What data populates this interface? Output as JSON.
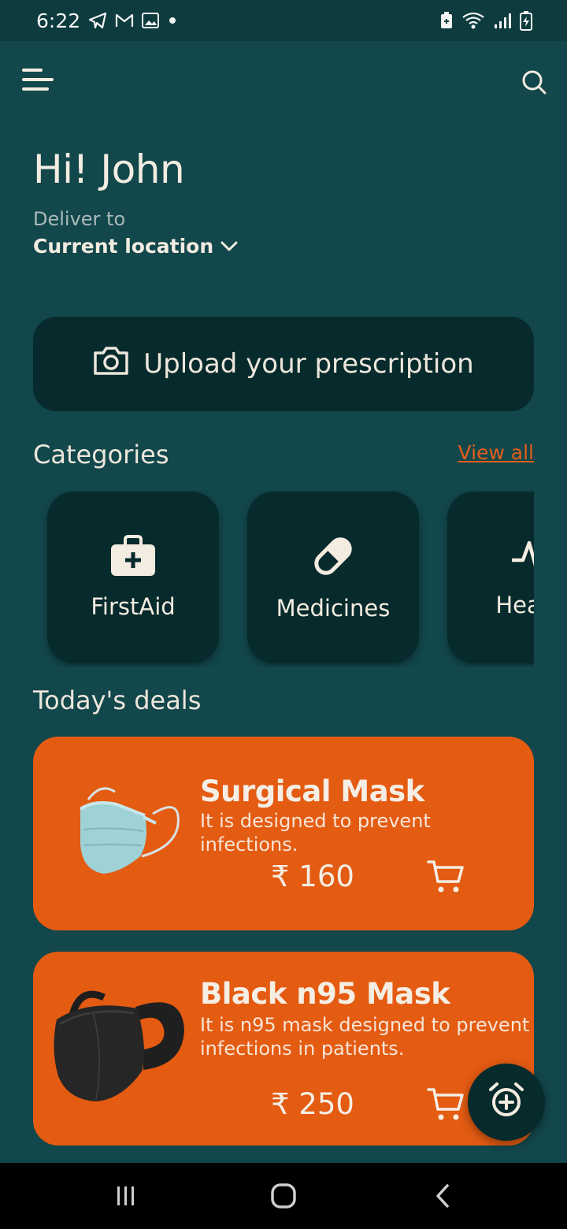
{
  "status_bar": {
    "time": "6:22",
    "left_icons": [
      "telegram-icon",
      "gmail-icon",
      "gallery-icon",
      "notification-dot-icon"
    ],
    "right_icons": [
      "battery-saver-icon",
      "wifi-icon",
      "signal-icon",
      "battery-charging-icon"
    ]
  },
  "header": {
    "menu_icon": "menu-icon",
    "search_icon": "search-icon"
  },
  "greeting": "Hi! John",
  "delivery": {
    "label": "Deliver to",
    "location": "Current location"
  },
  "upload": {
    "label": "Upload your prescription",
    "icon": "camera-icon"
  },
  "categories": {
    "title": "Categories",
    "view_all": "View all",
    "items": [
      {
        "label": "FirstAid",
        "icon": "first-aid-kit-icon"
      },
      {
        "label": "Medicines",
        "icon": "pill-icon"
      },
      {
        "label": "Health",
        "icon": "heartbeat-icon"
      }
    ]
  },
  "deals": {
    "title": "Today's deals",
    "items": [
      {
        "name": "Surgical Mask",
        "description": "It is designed to prevent infections.",
        "price": "₹ 160",
        "image": "surgical-mask-image",
        "icon": "cart-icon"
      },
      {
        "name": "Black n95 Mask",
        "description": "It is n95 mask designed to prevent infections in patients.",
        "price": "₹ 250",
        "image": "black-mask-image",
        "icon": "cart-icon"
      }
    ]
  },
  "fab": {
    "icon": "alarm-add-icon"
  },
  "nav_bar": {
    "icons": [
      "recent-apps-icon",
      "home-icon",
      "back-icon"
    ]
  },
  "colors": {
    "background": "#12474b",
    "card_dark": "#072a2c",
    "accent": "#e45b12",
    "text": "#f3ece1"
  }
}
